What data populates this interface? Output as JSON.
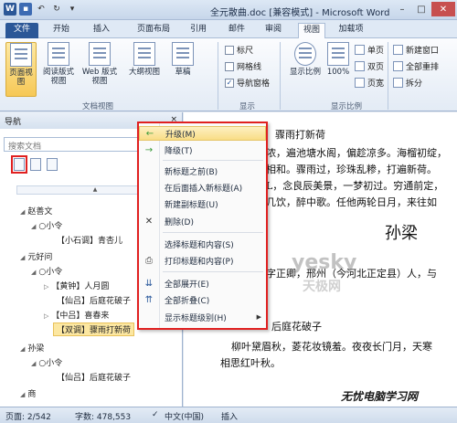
{
  "window": {
    "title": "全元散曲.doc [兼容模式] - Microsoft Word",
    "app_icon": "W"
  },
  "quick_access": {
    "undo_icon": "↶",
    "redo_icon": "↻"
  },
  "tabs": [
    "文件",
    "开始",
    "插入",
    "页面布局",
    "引用",
    "邮件",
    "审阅",
    "视图",
    "加载项"
  ],
  "ribbon": {
    "views": [
      "页面视图",
      "阅读版式视图",
      "Web 版式视图",
      "大纲视图",
      "草稿"
    ],
    "group_doc_views": "文档视图",
    "show_items": [
      "标尺",
      "网格线",
      "导航窗格"
    ],
    "show_checked": [
      false,
      false,
      true
    ],
    "group_show": "显示",
    "zoom_label": "显示比例",
    "zoom_pct": "100%",
    "zoom_items": [
      "单页",
      "双页",
      "页宽"
    ],
    "group_zoom": "显示比例",
    "window_items": [
      "新建窗口",
      "全部重排",
      "拆分"
    ]
  },
  "nav": {
    "title": "导航",
    "close": "×",
    "search_placeholder": "搜索文档",
    "tree": [
      {
        "text": "赵善文",
        "level": 0
      },
      {
        "text": "○小令",
        "level": 1
      },
      {
        "text": "【小石调】青杏儿",
        "level": 2
      },
      {
        "text": "元好问",
        "level": 0
      },
      {
        "text": "○小令",
        "level": 1
      },
      {
        "text": "【黄钟】人月圆",
        "level": 2
      },
      {
        "text": "【仙吕】后庭花破子",
        "level": 2
      },
      {
        "text": "【中吕】喜春来",
        "level": 2
      },
      {
        "text": "【双调】骤雨打新荷",
        "level": 2
      },
      {
        "text": "孙梁",
        "level": 0
      },
      {
        "text": "○小令",
        "level": 1
      },
      {
        "text": "【仙吕】后庭花破子",
        "level": 2
      },
      {
        "text": "商",
        "level": 0
      }
    ]
  },
  "doc": {
    "lines": [
      "骤雨打新荷",
      "浓，遍池塘水阁，偏趁凉多。海榴初绽，",
      "相和。骤雨过，珍珠乱糁，打遍新荷。",
      "L，念良辰美景，一梦初过。穷通前定，",
      "几饮，醉中歌。任他两轮日月，来往如",
      "孙梁",
      "字正卿，邢州（今河北正定县）人，与",
      "后庭花破子",
      "柳叶黛眉秋，菱花妆镜羞。夜夜长门月，天寒",
      "相思红叶秋。"
    ],
    "watermark_1": "yesky",
    "watermark_2": "天极网",
    "corner_mark": "无忧电脑学习网"
  },
  "context_menu": {
    "items": [
      {
        "icon": "←",
        "label": "升级(M)"
      },
      {
        "icon": "→",
        "label": "降级(T)"
      },
      {
        "icon": "",
        "label": "新标题之前(B)"
      },
      {
        "icon": "",
        "label": "在后面插入新标题(A)"
      },
      {
        "icon": "",
        "label": "新建副标题(U)"
      },
      {
        "icon": "✕",
        "label": "删除(D)"
      },
      {
        "icon": "",
        "label": "选择标题和内容(S)"
      },
      {
        "icon": "⎙",
        "label": "打印标题和内容(P)"
      },
      {
        "icon": "⇊",
        "label": "全部展开(E)"
      },
      {
        "icon": "⇈",
        "label": "全部折叠(C)"
      },
      {
        "icon": "",
        "label": "显示标题级别(H)"
      }
    ]
  },
  "status": {
    "page": "页面: 2/542",
    "words": "字数: 478,553",
    "language": "中文(中国)",
    "mode": "插入"
  }
}
